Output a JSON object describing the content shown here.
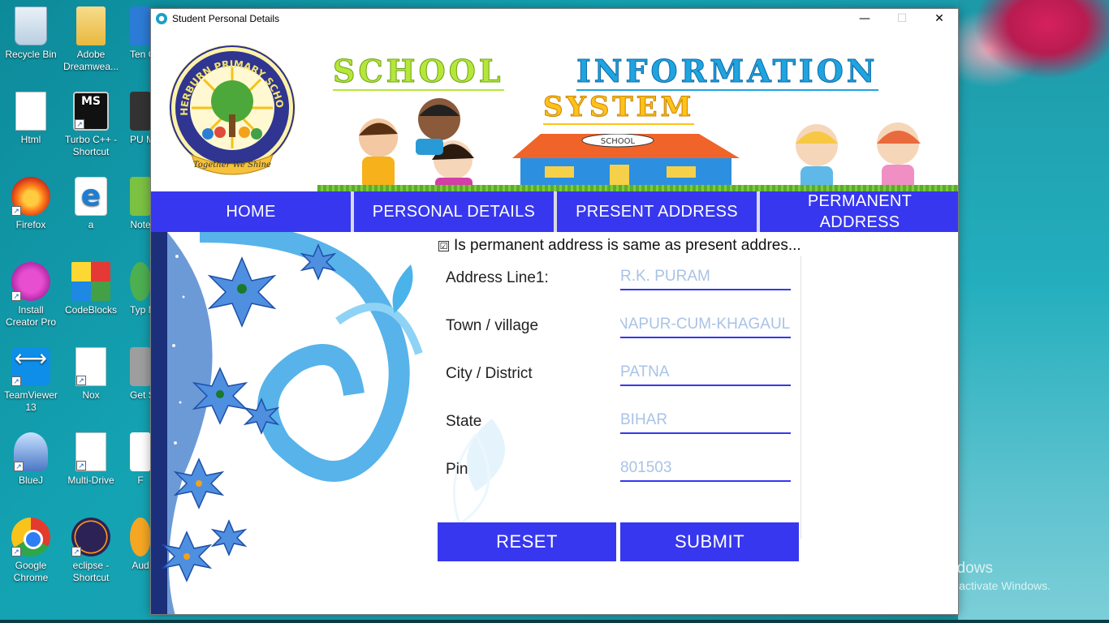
{
  "desktop": {
    "icons": [
      {
        "label": "Recycle Bin"
      },
      {
        "label": "Adobe Dreamwea..."
      },
      {
        "label": "Html"
      },
      {
        "label": "Turbo C++ - Shortcut"
      },
      {
        "label": "Firefox"
      },
      {
        "label": "a"
      },
      {
        "label": "Install Creator Pro"
      },
      {
        "label": "CodeBlocks"
      },
      {
        "label": "TeamViewer 13"
      },
      {
        "label": "Nox"
      },
      {
        "label": "BlueJ"
      },
      {
        "label": "Multi-Drive"
      },
      {
        "label": "Google Chrome"
      },
      {
        "label": "eclipse - Shortcut"
      }
    ],
    "partial_labels": [
      "Ten Gam",
      "PU MO",
      "Note",
      "Typ Mas",
      "Get S With",
      "F",
      "Aud"
    ],
    "activate_windows": {
      "title": "Activate Windows",
      "subtitle": "Go to Settings to activate Windows."
    }
  },
  "window": {
    "title": "Student Personal Details",
    "controls": {
      "minimize": "—",
      "maximize": "☐",
      "close": "✕"
    }
  },
  "banner": {
    "school_name": "SHERBURN PRIMARY SCHOOL",
    "motto": "Together We Shine",
    "title_part1": "SCHOOL",
    "title_part2": "INFORMATION",
    "title_part3": "SYSTEM",
    "building_sign": "SCHOOL"
  },
  "nav": {
    "home": "HOME",
    "personal_details": "PERSONAL DETAILS",
    "present_address": "PRESENT ADDRESS",
    "permanent_address": "PERMANENT ADDRESS"
  },
  "form": {
    "same_address_checkbox": {
      "label": "Is permanent address is same as present addres...",
      "checked": true,
      "mark": "☑"
    },
    "fields": {
      "address_line1": {
        "label": "Address Line1:",
        "value": "R.K. PURAM"
      },
      "town": {
        "label": "Town / village",
        "value": "NAPUR-CUM-KHAGAUL"
      },
      "city": {
        "label": "City / District",
        "value": "PATNA"
      },
      "state": {
        "label": "State",
        "value": "BIHAR"
      },
      "pin": {
        "label": "Pin",
        "value": "801503"
      }
    },
    "reset_label": "RESET",
    "submit_label": "SUBMIT"
  },
  "colors": {
    "nav_blue": "#3737f0",
    "title_green": "#b7e63a",
    "title_blue": "#1fa4e0",
    "title_yellow": "#ffc21a"
  }
}
